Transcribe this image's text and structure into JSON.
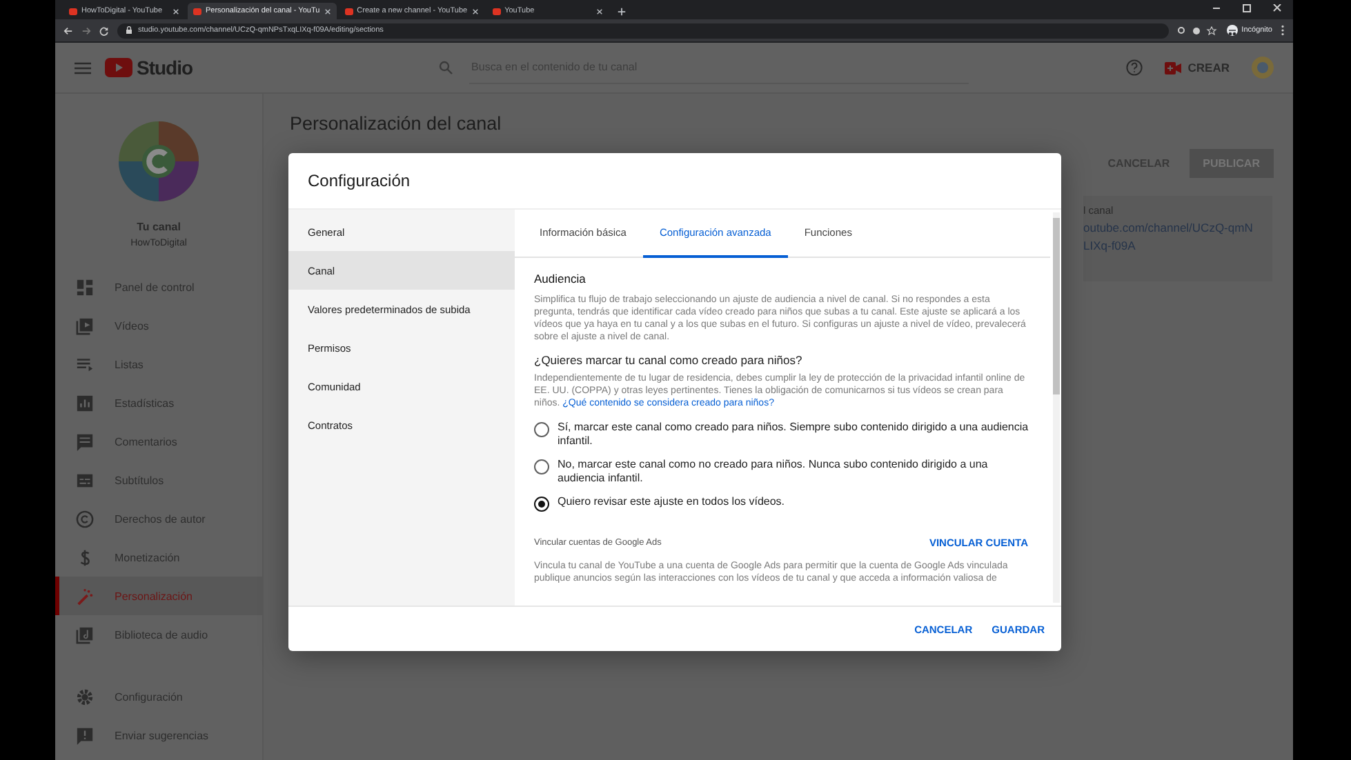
{
  "browser": {
    "tabs": [
      {
        "title": "HowToDigital - YouTube",
        "selected": false
      },
      {
        "title": "Personalización del canal - YouTu",
        "selected": true
      },
      {
        "title": "Create a new channel - YouTube",
        "selected": false
      },
      {
        "title": "YouTube",
        "selected": false
      }
    ],
    "url": "studio.youtube.com/channel/UCzQ-qmNPsTxqLIXq-f09A/editing/sections",
    "profile": "Incógnito"
  },
  "header": {
    "logo": "Studio",
    "search_placeholder": "Busca en el contenido de tu canal",
    "create_button": "CREAR"
  },
  "sidebar": {
    "channel_title": "Tu canal",
    "channel_name": "HowToDigital",
    "items": [
      {
        "label": "Panel de control",
        "selected": false
      },
      {
        "label": "Vídeos",
        "selected": false
      },
      {
        "label": "Listas",
        "selected": false
      },
      {
        "label": "Estadísticas",
        "selected": false
      },
      {
        "label": "Comentarios",
        "selected": false
      },
      {
        "label": "Subtítulos",
        "selected": false
      },
      {
        "label": "Derechos de autor",
        "selected": false
      },
      {
        "label": "Monetización",
        "selected": false
      },
      {
        "label": "Personalización",
        "selected": true
      },
      {
        "label": "Biblioteca de audio",
        "selected": false
      }
    ],
    "bottom_items": [
      {
        "label": "Configuración"
      },
      {
        "label": "Enviar sugerencias"
      }
    ]
  },
  "page": {
    "title": "Personalización del canal",
    "cancel_button": "CANCELAR",
    "publish_button": "PUBLICAR",
    "url_card": {
      "label": "l canal",
      "url_lines": [
        "outube.com/channel/UCzQ-qmN",
        "LIXq-f09A"
      ]
    }
  },
  "dialog": {
    "title": "Configuración",
    "nav": [
      {
        "label": "General",
        "selected": false
      },
      {
        "label": "Canal",
        "selected": true
      },
      {
        "label": "Valores predeterminados de subida",
        "selected": false
      },
      {
        "label": "Permisos",
        "selected": false
      },
      {
        "label": "Comunidad",
        "selected": false
      },
      {
        "label": "Contratos",
        "selected": false
      }
    ],
    "tabs": [
      {
        "label": "Información básica",
        "selected": false
      },
      {
        "label": "Configuración avanzada",
        "selected": true
      },
      {
        "label": "Funciones",
        "selected": false
      }
    ],
    "section_title": "Audiencia",
    "section_text": "Simplifica tu flujo de trabajo seleccionando un ajuste de audiencia a nivel de canal. Si no respondes a esta pregunta, tendrás que identificar cada vídeo creado para niños que subas a tu canal. Este ajuste se aplicará a los vídeos que ya haya en tu canal y a los que subas en el futuro. Si configuras un ajuste a nivel de vídeo, prevalecerá sobre el ajuste a nivel de canal.",
    "question": "¿Quieres marcar tu canal como creado para niños?",
    "question_text": "Independientemente de tu lugar de residencia, debes cumplir la ley de protección de la privacidad infantil online de EE. UU. (COPPA) y otras leyes pertinentes. Tienes la obligación de comunicarnos si tus vídeos se crean para niños.",
    "question_link": "¿Qué contenido se considera creado para niños?",
    "options": [
      {
        "label": "Sí, marcar este canal como creado para niños. Siempre subo contenido dirigido a una audiencia infantil.",
        "selected": false
      },
      {
        "label": "No, marcar este canal como no creado para niños. Nunca subo contenido dirigido a una audiencia infantil.",
        "selected": false
      },
      {
        "label": "Quiero revisar este ajuste en todos los vídeos.",
        "selected": true
      }
    ],
    "ads_title": "Vincular cuentas de Google Ads",
    "ads_button": "VINCULAR CUENTA",
    "ads_text": "Vincula tu canal de YouTube a una cuenta de Google Ads para permitir que la cuenta de Google Ads vinculada publique anuncios según las interacciones con los vídeos de tu canal y que acceda a información valiosa de",
    "cancel_button": "CANCELAR",
    "save_button": "GUARDAR"
  }
}
